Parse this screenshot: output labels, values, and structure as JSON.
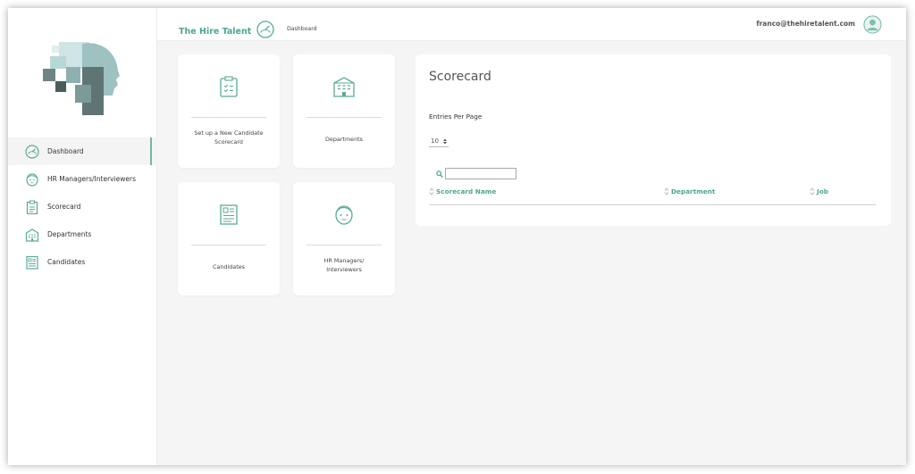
{
  "colors": {
    "accent": "#6cb8a6",
    "brand_text": "#4aa892",
    "icon_stroke": "#5aaa98"
  },
  "header": {
    "brand": "The Hire Talent",
    "brand_icon": "dashboard-gauge-icon",
    "breadcrumb": "Dashboard",
    "user_email": "franco@thehiretalent.com",
    "avatar_icon": "user-avatar-icon"
  },
  "sidebar": {
    "logo_icon": "head-silhouette-logo",
    "items": [
      {
        "label": "Dashboard",
        "icon": "gauge-icon",
        "active": true
      },
      {
        "label": "HR Managers/Interviewers",
        "icon": "face-icon",
        "active": false
      },
      {
        "label": "Scorecard",
        "icon": "clipboard-icon",
        "active": false
      },
      {
        "label": "Departments",
        "icon": "building-icon",
        "active": false
      },
      {
        "label": "Candidates",
        "icon": "id-card-icon",
        "active": false
      }
    ]
  },
  "tiles": [
    {
      "label": "Set up a New Candidate\nScorecard",
      "icon": "clipboard-check-icon"
    },
    {
      "label": "Departments",
      "icon": "building-icon"
    },
    {
      "label": "Candidates",
      "icon": "id-card-icon"
    },
    {
      "label": "HR Managers/\nInterviewers",
      "icon": "face-icon"
    }
  ],
  "scorecard": {
    "title": "Scorecard",
    "entries_label": "Entries Per Page",
    "entries_value": "10",
    "search_value": "",
    "columns": [
      "Scorecard Name",
      "Department",
      "Job"
    ]
  }
}
